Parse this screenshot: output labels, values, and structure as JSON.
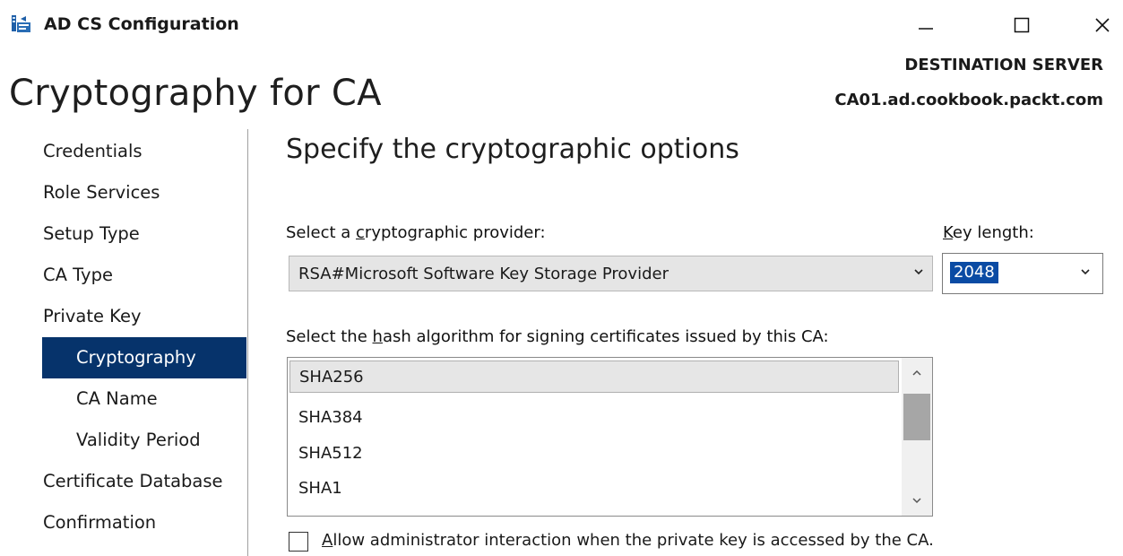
{
  "window": {
    "title": "AD CS Configuration",
    "icon": "ad-cs-app-icon",
    "controls": [
      "minimize-icon",
      "maximize-icon",
      "close-icon"
    ]
  },
  "header": {
    "page_title": "Cryptography for CA",
    "destination_label": "DESTINATION SERVER",
    "destination_server": "CA01.ad.cookbook.packt.com"
  },
  "nav": {
    "items": [
      {
        "label": "Credentials",
        "level": 0,
        "selected": false
      },
      {
        "label": "Role Services",
        "level": 0,
        "selected": false
      },
      {
        "label": "Setup Type",
        "level": 0,
        "selected": false
      },
      {
        "label": "CA Type",
        "level": 0,
        "selected": false
      },
      {
        "label": "Private Key",
        "level": 0,
        "selected": false
      },
      {
        "label": "Cryptography",
        "level": 1,
        "selected": true
      },
      {
        "label": "CA Name",
        "level": 1,
        "selected": false
      },
      {
        "label": "Validity Period",
        "level": 1,
        "selected": false
      },
      {
        "label": "Certificate Database",
        "level": 0,
        "selected": false
      },
      {
        "label": "Confirmation",
        "level": 0,
        "selected": false
      }
    ],
    "selected_color": "#06336b"
  },
  "main": {
    "heading": "Specify the cryptographic options",
    "provider": {
      "label_pre": "Select a ",
      "label_accel": "c",
      "label_post": "ryptographic provider:",
      "value": "RSA#Microsoft Software Key Storage Provider"
    },
    "key_length": {
      "label_accel": "K",
      "label_post": "ey length:",
      "value": "2048"
    },
    "hash": {
      "label_pre": "Select the ",
      "label_accel": "h",
      "label_post": "ash algorithm for signing certificates issued by this CA:",
      "options": [
        "SHA256",
        "SHA384",
        "SHA512",
        "SHA1"
      ],
      "selected": "SHA256"
    },
    "allow_interaction": {
      "label_accel": "A",
      "label_post": "llow administrator interaction when the private key is accessed by the CA.",
      "checked": false
    }
  }
}
